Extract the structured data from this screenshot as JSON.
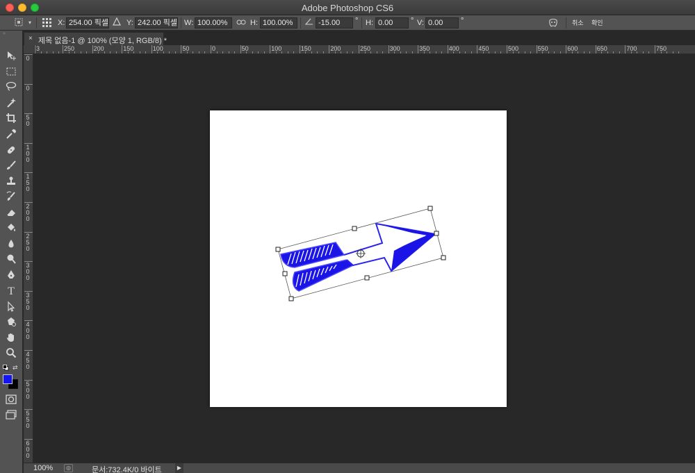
{
  "window": {
    "title": "Adobe Photoshop CS6"
  },
  "options_bar": {
    "x_label": "X:",
    "x_value": "254.00 픽셀",
    "y_label": "Y:",
    "y_value": "242.00 픽셀",
    "w_label": "W:",
    "w_value": "100.00%",
    "h_label": "H:",
    "h_value": "100.00%",
    "angle_value": "-15.00",
    "degree_symbol": "°",
    "skew_h_label": "H:",
    "skew_h_value": "0.00",
    "skew_v_label": "V:",
    "skew_v_value": "0.00",
    "cancel_label": "취소",
    "commit_label": "확인"
  },
  "document": {
    "tab_title": "제목 없음-1 @ 100% (모양 1, RGB/8) *",
    "close_glyph": "×"
  },
  "rulers": {
    "horizontal": [
      "3",
      "250",
      "200",
      "150",
      "100",
      "50",
      "0",
      "50",
      "100",
      "150",
      "200",
      "250",
      "300",
      "350",
      "400",
      "450",
      "500",
      "550",
      "600",
      "650",
      "700",
      "750"
    ],
    "vertical": [
      "0",
      "0",
      "5 0",
      "1 0 0",
      "1 5 0",
      "2 0 0",
      "2 5 0",
      "3 0 0",
      "3 5 0",
      "4 0 0",
      "4 5 0",
      "5 0 0",
      "5 5 0",
      "6 0 0"
    ]
  },
  "status_bar": {
    "zoom": "100%",
    "doc_info": "문서:732.4K/0 바이트",
    "arrow_glyph": "▶"
  },
  "colors": {
    "foreground": "#1515f0",
    "background": "#000000",
    "arrow_fill": "#1a14e6"
  },
  "tools": [
    "move-tool-icon",
    "marquee-tool-icon",
    "lasso-tool-icon",
    "magic-wand-tool-icon",
    "crop-tool-icon",
    "eyedropper-tool-icon",
    "healing-brush-tool-icon",
    "brush-tool-icon",
    "clone-stamp-tool-icon",
    "history-brush-tool-icon",
    "eraser-tool-icon",
    "paint-bucket-tool-icon",
    "blur-tool-icon",
    "dodge-tool-icon",
    "pen-tool-icon",
    "type-tool-icon",
    "path-selection-tool-icon",
    "shape-tool-icon",
    "hand-tool-icon",
    "zoom-tool-icon"
  ]
}
